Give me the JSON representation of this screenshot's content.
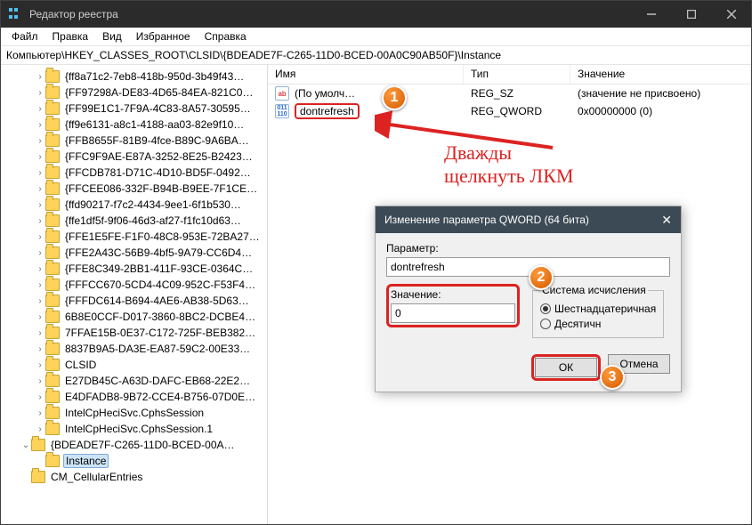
{
  "titlebar": {
    "title": "Редактор реестра"
  },
  "menu": {
    "file": "Файл",
    "edit": "Правка",
    "view": "Вид",
    "favorites": "Избранное",
    "help": "Справка"
  },
  "address": "Компьютер\\HKEY_CLASSES_ROOT\\CLSID\\{BDEADE7F-C265-11D0-BCED-00A0C90AB50F}\\Instance",
  "tree": [
    "{ff8a71c2-7eb8-418b-950d-3b49f43…",
    "{FF97298A-DE83-4D65-84EA-821C0…",
    "{FF99E1C1-7F9A-4C83-8A57-30595…",
    "{ff9e6131-a8c1-4188-aa03-82e9f10…",
    "{FFB8655F-81B9-4fce-B89C-9A6BA…",
    "{FFC9F9AE-E87A-3252-8E25-B2423…",
    "{FFCDB781-D71C-4D10-BD5F-0492…",
    "{FFCEE086-332F-B94B-B9EE-7F1CE…",
    "{ffd90217-f7c2-4434-9ee1-6f1b530…",
    "{ffe1df5f-9f06-46d3-af27-f1fc10d63…",
    "{FFE1E5FE-F1F0-48C8-953E-72BA27…",
    "{FFE2A43C-56B9-4bf5-9A79-CC6D4…",
    "{FFE8C349-2BB1-411F-93CE-0364C…",
    "{FFFCC670-5CD4-4C09-952C-F53F4…",
    "{FFFDC614-B694-4AE6-AB38-5D63…",
    "6B8E0CCF-D017-3860-8BC2-DCBE4…",
    "7FFAE15B-0E37-C172-725F-BEB382…",
    "8837B9A5-DA3E-EA87-59C2-00E33…",
    "CLSID",
    "E27DB45C-A63D-DAFC-EB68-22E2…",
    "E4DFADB8-9B72-CCE4-B756-07D0E…",
    "IntelCpHeciSvc.CphsSession",
    "IntelCpHeciSvc.CphsSession.1"
  ],
  "current": {
    "key": "{BDEADE7F-C265-11D0-BCED-00A…",
    "child": "Instance"
  },
  "afterKey": "CM_CellularEntries",
  "list": {
    "headers": {
      "name": "Имя",
      "type": "Тип",
      "value": "Значение"
    },
    "rows": [
      {
        "icon": "str",
        "name": "(По умолч…",
        "type": "REG_SZ",
        "value": "(значение не присвоено)"
      },
      {
        "icon": "num",
        "name": "dontrefresh",
        "type": "REG_QWORD",
        "value": "0x00000000 (0)"
      }
    ]
  },
  "dialog": {
    "title": "Изменение параметра QWORD (64 бита)",
    "paramLabel": "Параметр:",
    "paramValue": "dontrefresh",
    "valueLabel": "Значение:",
    "valueValue": "0",
    "baseLabel": "Система исчисления",
    "hex": "Шестнадцатеричная",
    "dec": "Десятичн",
    "ok": "ОК",
    "cancel": "Отмена"
  },
  "annot": {
    "line1": "Дважды",
    "line2": "щелкнуть ЛКМ"
  },
  "badges": {
    "b1": "1",
    "b2": "2",
    "b3": "3"
  }
}
